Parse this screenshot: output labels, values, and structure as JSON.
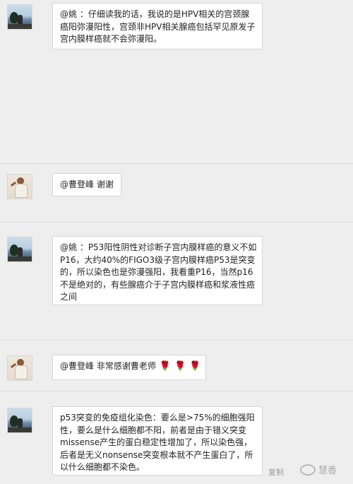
{
  "messages": [
    {
      "avatar": "lake-photo-avatar",
      "lines": [
        "@姚 ：仔细读我的话，我说的是HPV相关的宫颈腺",
        "癌阳弥漫阳性，宫颈非HPV相关腺癌包括罕见原发子",
        "宫内膜样癌就不会弥漫阳。"
      ]
    },
    {
      "avatar": "doll-avatar",
      "lines": [
        "@曹登峰 谢谢"
      ]
    },
    {
      "avatar": "lake-photo-avatar",
      "lines": [
        "@姚 ：P53阳性阴性对诊断子宫内膜样癌的意义不如",
        "P16，大约40%的FIGO3级子宫内膜样癌P53是突变",
        "的，所以染色也是弥漫强阳，我看重P16，当然p16",
        "不是绝对的，有些腺癌介于子宫内膜样癌和浆液性癌",
        "之间"
      ]
    },
    {
      "avatar": "doll-avatar",
      "lines": [
        "@曹登峰 非常感谢曹老师"
      ],
      "emoji": [
        "rose-emoji",
        "rose-emoji",
        "rose-emoji"
      ]
    },
    {
      "avatar": "lake-photo-avatar",
      "lines": [
        "p53突变的免疫组化染色：要么是>75%的细胞强阳",
        "性，要么是什么细胞都不阳，前者是由于错义突变",
        "missense产生的蛋白稳定性增加了，所以染色强，",
        "后者是无义nonsense突变根本就不产生蛋白了，所",
        "以什么细胞都不染色。"
      ]
    }
  ],
  "footer": {
    "copy_label": "复制",
    "watermark_text": "慧香"
  }
}
